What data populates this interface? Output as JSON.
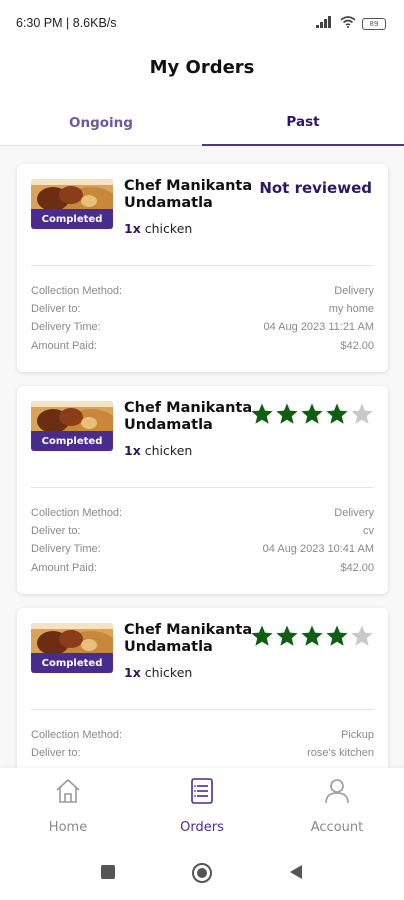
{
  "status_bar": {
    "time_speed": "6:30 PM | 8.6KB/s",
    "battery": "89"
  },
  "header": {
    "title": "My Orders"
  },
  "tabs": [
    {
      "label": "Ongoing",
      "active": false
    },
    {
      "label": "Past",
      "active": true
    }
  ],
  "colors": {
    "accent": "#4a2c8f",
    "title_purple": "#2c1863",
    "star_filled": "#0f5e14",
    "star_empty": "#c9c9c9"
  },
  "orders": [
    {
      "chef": "Chef Manikanta Undamatla",
      "status_badge": "Completed",
      "review_text": "Not reviewed",
      "rating": null,
      "item_qty": "1x",
      "item_name": "chicken",
      "details": [
        {
          "label": "Collection Method:",
          "value": "Delivery"
        },
        {
          "label": "Deliver to:",
          "value": "my home"
        },
        {
          "label": "Delivery Time:",
          "value": "04 Aug 2023 11:21 AM"
        },
        {
          "label": "Amount Paid:",
          "value": "$42.00"
        }
      ]
    },
    {
      "chef": "Chef Manikanta Undamatla",
      "status_badge": "Completed",
      "review_text": "",
      "rating": 4,
      "rating_max": 5,
      "item_qty": "1x",
      "item_name": "chicken",
      "details": [
        {
          "label": "Collection Method:",
          "value": "Delivery"
        },
        {
          "label": "Deliver to:",
          "value": "cv"
        },
        {
          "label": "Delivery Time:",
          "value": "04 Aug 2023 10:41 AM"
        },
        {
          "label": "Amount Paid:",
          "value": "$42.00"
        }
      ]
    },
    {
      "chef": "Chef Manikanta Undamatla",
      "status_badge": "Completed",
      "review_text": "",
      "rating": 4,
      "rating_max": 5,
      "item_qty": "1x",
      "item_name": "chicken",
      "details": [
        {
          "label": "Collection Method:",
          "value": "Pickup"
        },
        {
          "label": "Deliver to:",
          "value": "rose's kitchen"
        }
      ]
    }
  ],
  "bottom_nav": [
    {
      "label": "Home",
      "icon": "home-icon",
      "active": false
    },
    {
      "label": "Orders",
      "icon": "orders-icon",
      "active": true
    },
    {
      "label": "Account",
      "icon": "account-icon",
      "active": false
    }
  ],
  "system_nav": {
    "icons": [
      "recents-square-icon",
      "home-circle-icon",
      "back-triangle-icon"
    ]
  }
}
